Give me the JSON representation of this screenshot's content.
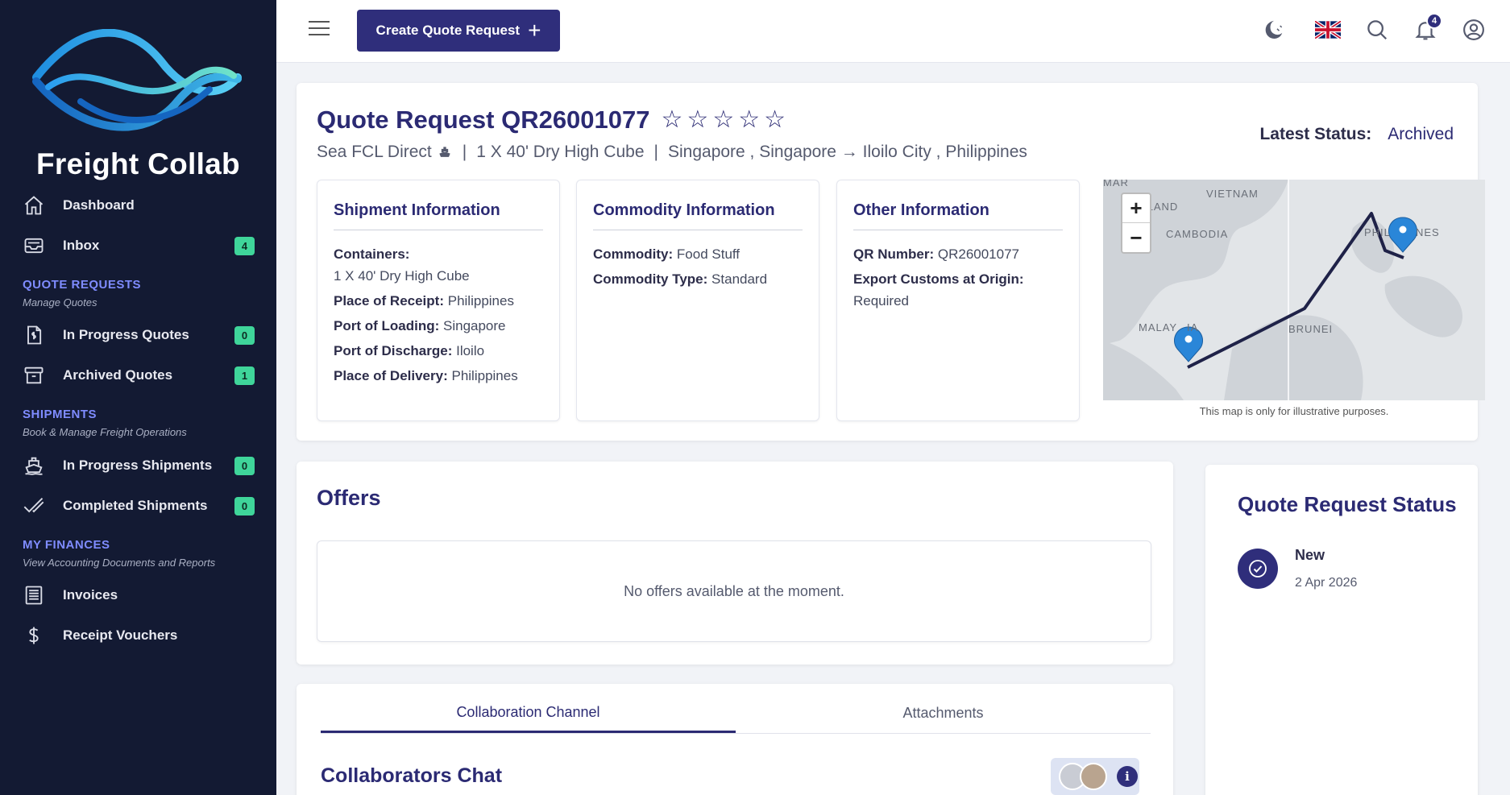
{
  "brand": {
    "name": "Freight Collab"
  },
  "sidebar": {
    "items": [
      {
        "label": "Dashboard",
        "icon": "home-icon"
      },
      {
        "label": "Inbox",
        "icon": "inbox-icon",
        "badge": "4"
      }
    ],
    "sections": [
      {
        "title": "QUOTE REQUESTS",
        "subtitle": "Manage Quotes",
        "items": [
          {
            "label": "In Progress Quotes",
            "icon": "dollar-document-icon",
            "badge": "0"
          },
          {
            "label": "Archived Quotes",
            "icon": "archive-box-icon",
            "badge": "1"
          }
        ]
      },
      {
        "title": "SHIPMENTS",
        "subtitle": "Book & Manage Freight Operations",
        "items": [
          {
            "label": "In Progress Shipments",
            "icon": "ship-icon",
            "badge": "0"
          },
          {
            "label": "Completed Shipments",
            "icon": "double-check-icon",
            "badge": "0"
          }
        ]
      },
      {
        "title": "MY FINANCES",
        "subtitle": "View Accounting Documents and Reports",
        "items": [
          {
            "label": "Invoices",
            "icon": "invoice-icon"
          },
          {
            "label": "Receipt Vouchers",
            "icon": "dollar-icon"
          }
        ]
      }
    ]
  },
  "topbar": {
    "create_label": "Create Quote Request",
    "notifications_count": "4"
  },
  "quote": {
    "title": "Quote Request QR26001077",
    "mode": "Sea FCL Direct",
    "containers_summary": "1 X 40' Dry High Cube",
    "route": "Singapore , Singapore → Iloilo City , Philippines",
    "latest_status_label": "Latest Status:",
    "latest_status_value": "Archived",
    "rating": 0,
    "rating_max": 5
  },
  "shipment_info": {
    "title": "Shipment Information",
    "containers_label": "Containers:",
    "containers_value": "1 X 40' Dry High Cube",
    "receipt_label": "Place of Receipt:",
    "receipt_value": "Philippines",
    "loading_label": "Port of Loading:",
    "loading_value": "Singapore",
    "discharge_label": "Port of Discharge:",
    "discharge_value": "Iloilo",
    "delivery_label": "Place of Delivery:",
    "delivery_value": "Philippines"
  },
  "commodity_info": {
    "title": "Commodity Information",
    "commodity_label": "Commodity:",
    "commodity_value": "Food Stuff",
    "type_label": "Commodity Type:",
    "type_value": "Standard"
  },
  "other_info": {
    "title": "Other Information",
    "qr_label": "QR Number:",
    "qr_value": "QR26001077",
    "customs_label": "Export Customs at Origin:",
    "customs_value": "Required"
  },
  "map": {
    "caption": "This map is only for illustrative purposes.",
    "labels": [
      "MAR",
      "ILAND",
      "VIETNAM",
      "CAMBODIA",
      "PHIL",
      "NES",
      "MALAY",
      "IA",
      "BRUNEI"
    ],
    "zoom_in": "+",
    "zoom_out": "−"
  },
  "offers": {
    "title": "Offers",
    "empty_text": "No offers available at the moment."
  },
  "status_panel": {
    "title": "Quote Request Status",
    "events": [
      {
        "name": "New",
        "date": "2 Apr 2026"
      }
    ]
  },
  "collab": {
    "tabs": [
      "Collaboration Channel",
      "Attachments"
    ],
    "chat_title": "Collaborators Chat"
  },
  "colors": {
    "sidebar_bg": "#131a33",
    "primary": "#2f2e7b",
    "badge_green": "#3fd59a",
    "section_accent": "#7f8cff"
  }
}
